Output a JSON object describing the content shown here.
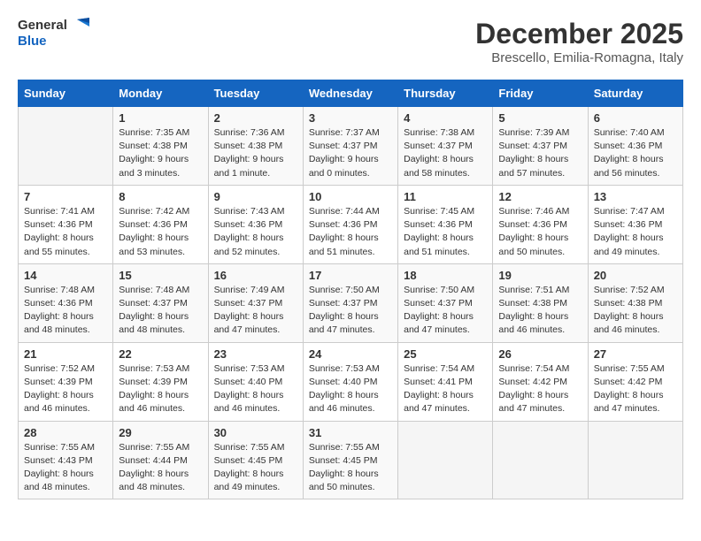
{
  "logo": {
    "line1": "General",
    "line2": "Blue"
  },
  "title": "December 2025",
  "subtitle": "Brescello, Emilia-Romagna, Italy",
  "days_of_week": [
    "Sunday",
    "Monday",
    "Tuesday",
    "Wednesday",
    "Thursday",
    "Friday",
    "Saturday"
  ],
  "weeks": [
    [
      {
        "day": "",
        "sunrise": "",
        "sunset": "",
        "daylight": ""
      },
      {
        "day": "1",
        "sunrise": "Sunrise: 7:35 AM",
        "sunset": "Sunset: 4:38 PM",
        "daylight": "Daylight: 9 hours and 3 minutes."
      },
      {
        "day": "2",
        "sunrise": "Sunrise: 7:36 AM",
        "sunset": "Sunset: 4:38 PM",
        "daylight": "Daylight: 9 hours and 1 minute."
      },
      {
        "day": "3",
        "sunrise": "Sunrise: 7:37 AM",
        "sunset": "Sunset: 4:37 PM",
        "daylight": "Daylight: 9 hours and 0 minutes."
      },
      {
        "day": "4",
        "sunrise": "Sunrise: 7:38 AM",
        "sunset": "Sunset: 4:37 PM",
        "daylight": "Daylight: 8 hours and 58 minutes."
      },
      {
        "day": "5",
        "sunrise": "Sunrise: 7:39 AM",
        "sunset": "Sunset: 4:37 PM",
        "daylight": "Daylight: 8 hours and 57 minutes."
      },
      {
        "day": "6",
        "sunrise": "Sunrise: 7:40 AM",
        "sunset": "Sunset: 4:36 PM",
        "daylight": "Daylight: 8 hours and 56 minutes."
      }
    ],
    [
      {
        "day": "7",
        "sunrise": "Sunrise: 7:41 AM",
        "sunset": "Sunset: 4:36 PM",
        "daylight": "Daylight: 8 hours and 55 minutes."
      },
      {
        "day": "8",
        "sunrise": "Sunrise: 7:42 AM",
        "sunset": "Sunset: 4:36 PM",
        "daylight": "Daylight: 8 hours and 53 minutes."
      },
      {
        "day": "9",
        "sunrise": "Sunrise: 7:43 AM",
        "sunset": "Sunset: 4:36 PM",
        "daylight": "Daylight: 8 hours and 52 minutes."
      },
      {
        "day": "10",
        "sunrise": "Sunrise: 7:44 AM",
        "sunset": "Sunset: 4:36 PM",
        "daylight": "Daylight: 8 hours and 51 minutes."
      },
      {
        "day": "11",
        "sunrise": "Sunrise: 7:45 AM",
        "sunset": "Sunset: 4:36 PM",
        "daylight": "Daylight: 8 hours and 51 minutes."
      },
      {
        "day": "12",
        "sunrise": "Sunrise: 7:46 AM",
        "sunset": "Sunset: 4:36 PM",
        "daylight": "Daylight: 8 hours and 50 minutes."
      },
      {
        "day": "13",
        "sunrise": "Sunrise: 7:47 AM",
        "sunset": "Sunset: 4:36 PM",
        "daylight": "Daylight: 8 hours and 49 minutes."
      }
    ],
    [
      {
        "day": "14",
        "sunrise": "Sunrise: 7:48 AM",
        "sunset": "Sunset: 4:36 PM",
        "daylight": "Daylight: 8 hours and 48 minutes."
      },
      {
        "day": "15",
        "sunrise": "Sunrise: 7:48 AM",
        "sunset": "Sunset: 4:37 PM",
        "daylight": "Daylight: 8 hours and 48 minutes."
      },
      {
        "day": "16",
        "sunrise": "Sunrise: 7:49 AM",
        "sunset": "Sunset: 4:37 PM",
        "daylight": "Daylight: 8 hours and 47 minutes."
      },
      {
        "day": "17",
        "sunrise": "Sunrise: 7:50 AM",
        "sunset": "Sunset: 4:37 PM",
        "daylight": "Daylight: 8 hours and 47 minutes."
      },
      {
        "day": "18",
        "sunrise": "Sunrise: 7:50 AM",
        "sunset": "Sunset: 4:37 PM",
        "daylight": "Daylight: 8 hours and 47 minutes."
      },
      {
        "day": "19",
        "sunrise": "Sunrise: 7:51 AM",
        "sunset": "Sunset: 4:38 PM",
        "daylight": "Daylight: 8 hours and 46 minutes."
      },
      {
        "day": "20",
        "sunrise": "Sunrise: 7:52 AM",
        "sunset": "Sunset: 4:38 PM",
        "daylight": "Daylight: 8 hours and 46 minutes."
      }
    ],
    [
      {
        "day": "21",
        "sunrise": "Sunrise: 7:52 AM",
        "sunset": "Sunset: 4:39 PM",
        "daylight": "Daylight: 8 hours and 46 minutes."
      },
      {
        "day": "22",
        "sunrise": "Sunrise: 7:53 AM",
        "sunset": "Sunset: 4:39 PM",
        "daylight": "Daylight: 8 hours and 46 minutes."
      },
      {
        "day": "23",
        "sunrise": "Sunrise: 7:53 AM",
        "sunset": "Sunset: 4:40 PM",
        "daylight": "Daylight: 8 hours and 46 minutes."
      },
      {
        "day": "24",
        "sunrise": "Sunrise: 7:53 AM",
        "sunset": "Sunset: 4:40 PM",
        "daylight": "Daylight: 8 hours and 46 minutes."
      },
      {
        "day": "25",
        "sunrise": "Sunrise: 7:54 AM",
        "sunset": "Sunset: 4:41 PM",
        "daylight": "Daylight: 8 hours and 47 minutes."
      },
      {
        "day": "26",
        "sunrise": "Sunrise: 7:54 AM",
        "sunset": "Sunset: 4:42 PM",
        "daylight": "Daylight: 8 hours and 47 minutes."
      },
      {
        "day": "27",
        "sunrise": "Sunrise: 7:55 AM",
        "sunset": "Sunset: 4:42 PM",
        "daylight": "Daylight: 8 hours and 47 minutes."
      }
    ],
    [
      {
        "day": "28",
        "sunrise": "Sunrise: 7:55 AM",
        "sunset": "Sunset: 4:43 PM",
        "daylight": "Daylight: 8 hours and 48 minutes."
      },
      {
        "day": "29",
        "sunrise": "Sunrise: 7:55 AM",
        "sunset": "Sunset: 4:44 PM",
        "daylight": "Daylight: 8 hours and 48 minutes."
      },
      {
        "day": "30",
        "sunrise": "Sunrise: 7:55 AM",
        "sunset": "Sunset: 4:45 PM",
        "daylight": "Daylight: 8 hours and 49 minutes."
      },
      {
        "day": "31",
        "sunrise": "Sunrise: 7:55 AM",
        "sunset": "Sunset: 4:45 PM",
        "daylight": "Daylight: 8 hours and 50 minutes."
      },
      {
        "day": "",
        "sunrise": "",
        "sunset": "",
        "daylight": ""
      },
      {
        "day": "",
        "sunrise": "",
        "sunset": "",
        "daylight": ""
      },
      {
        "day": "",
        "sunrise": "",
        "sunset": "",
        "daylight": ""
      }
    ]
  ]
}
